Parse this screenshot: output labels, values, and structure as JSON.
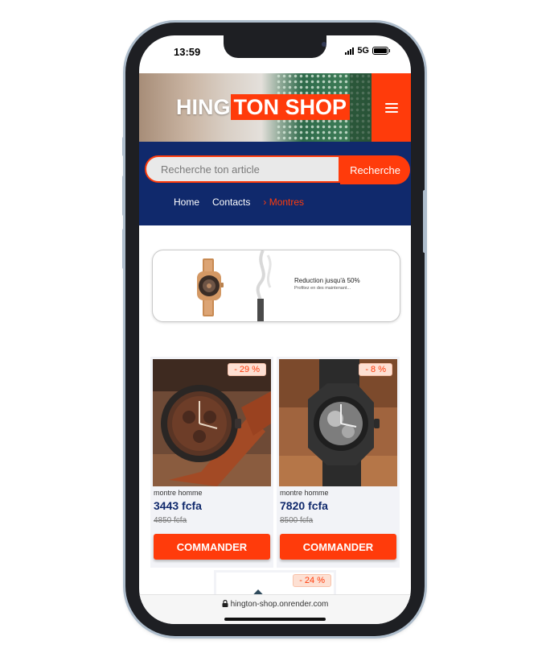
{
  "status_bar": {
    "time": "13:59",
    "network": "5G"
  },
  "header": {
    "logo_part1": "HING",
    "logo_part2": "TON SHOP",
    "menu_icon": "hamburger-icon",
    "accent_color": "#ff3b0b",
    "navy_color": "#10296c"
  },
  "search": {
    "placeholder": "Recherche ton article",
    "button_label": "Recherche"
  },
  "nav": {
    "home": "Home",
    "contacts": "Contacts",
    "current": "› Montres"
  },
  "promo": {
    "title": "Reduction jusqu'à 50%",
    "subtitle": "Profitez en des maintenant..."
  },
  "products": [
    {
      "discount": "- 29 %",
      "category": "montre homme",
      "price": "3443 fcfa",
      "old_price": "4850 fcfa",
      "button": "COMMANDER"
    },
    {
      "discount": "- 8 %",
      "category": "montre homme",
      "price": "7820 fcfa",
      "old_price": "8500 fcfa",
      "button": "COMMANDER"
    },
    {
      "discount": "- 24 %"
    }
  ],
  "browser": {
    "url": "hington-shop.onrender.com",
    "lock_icon": "lock-icon"
  }
}
